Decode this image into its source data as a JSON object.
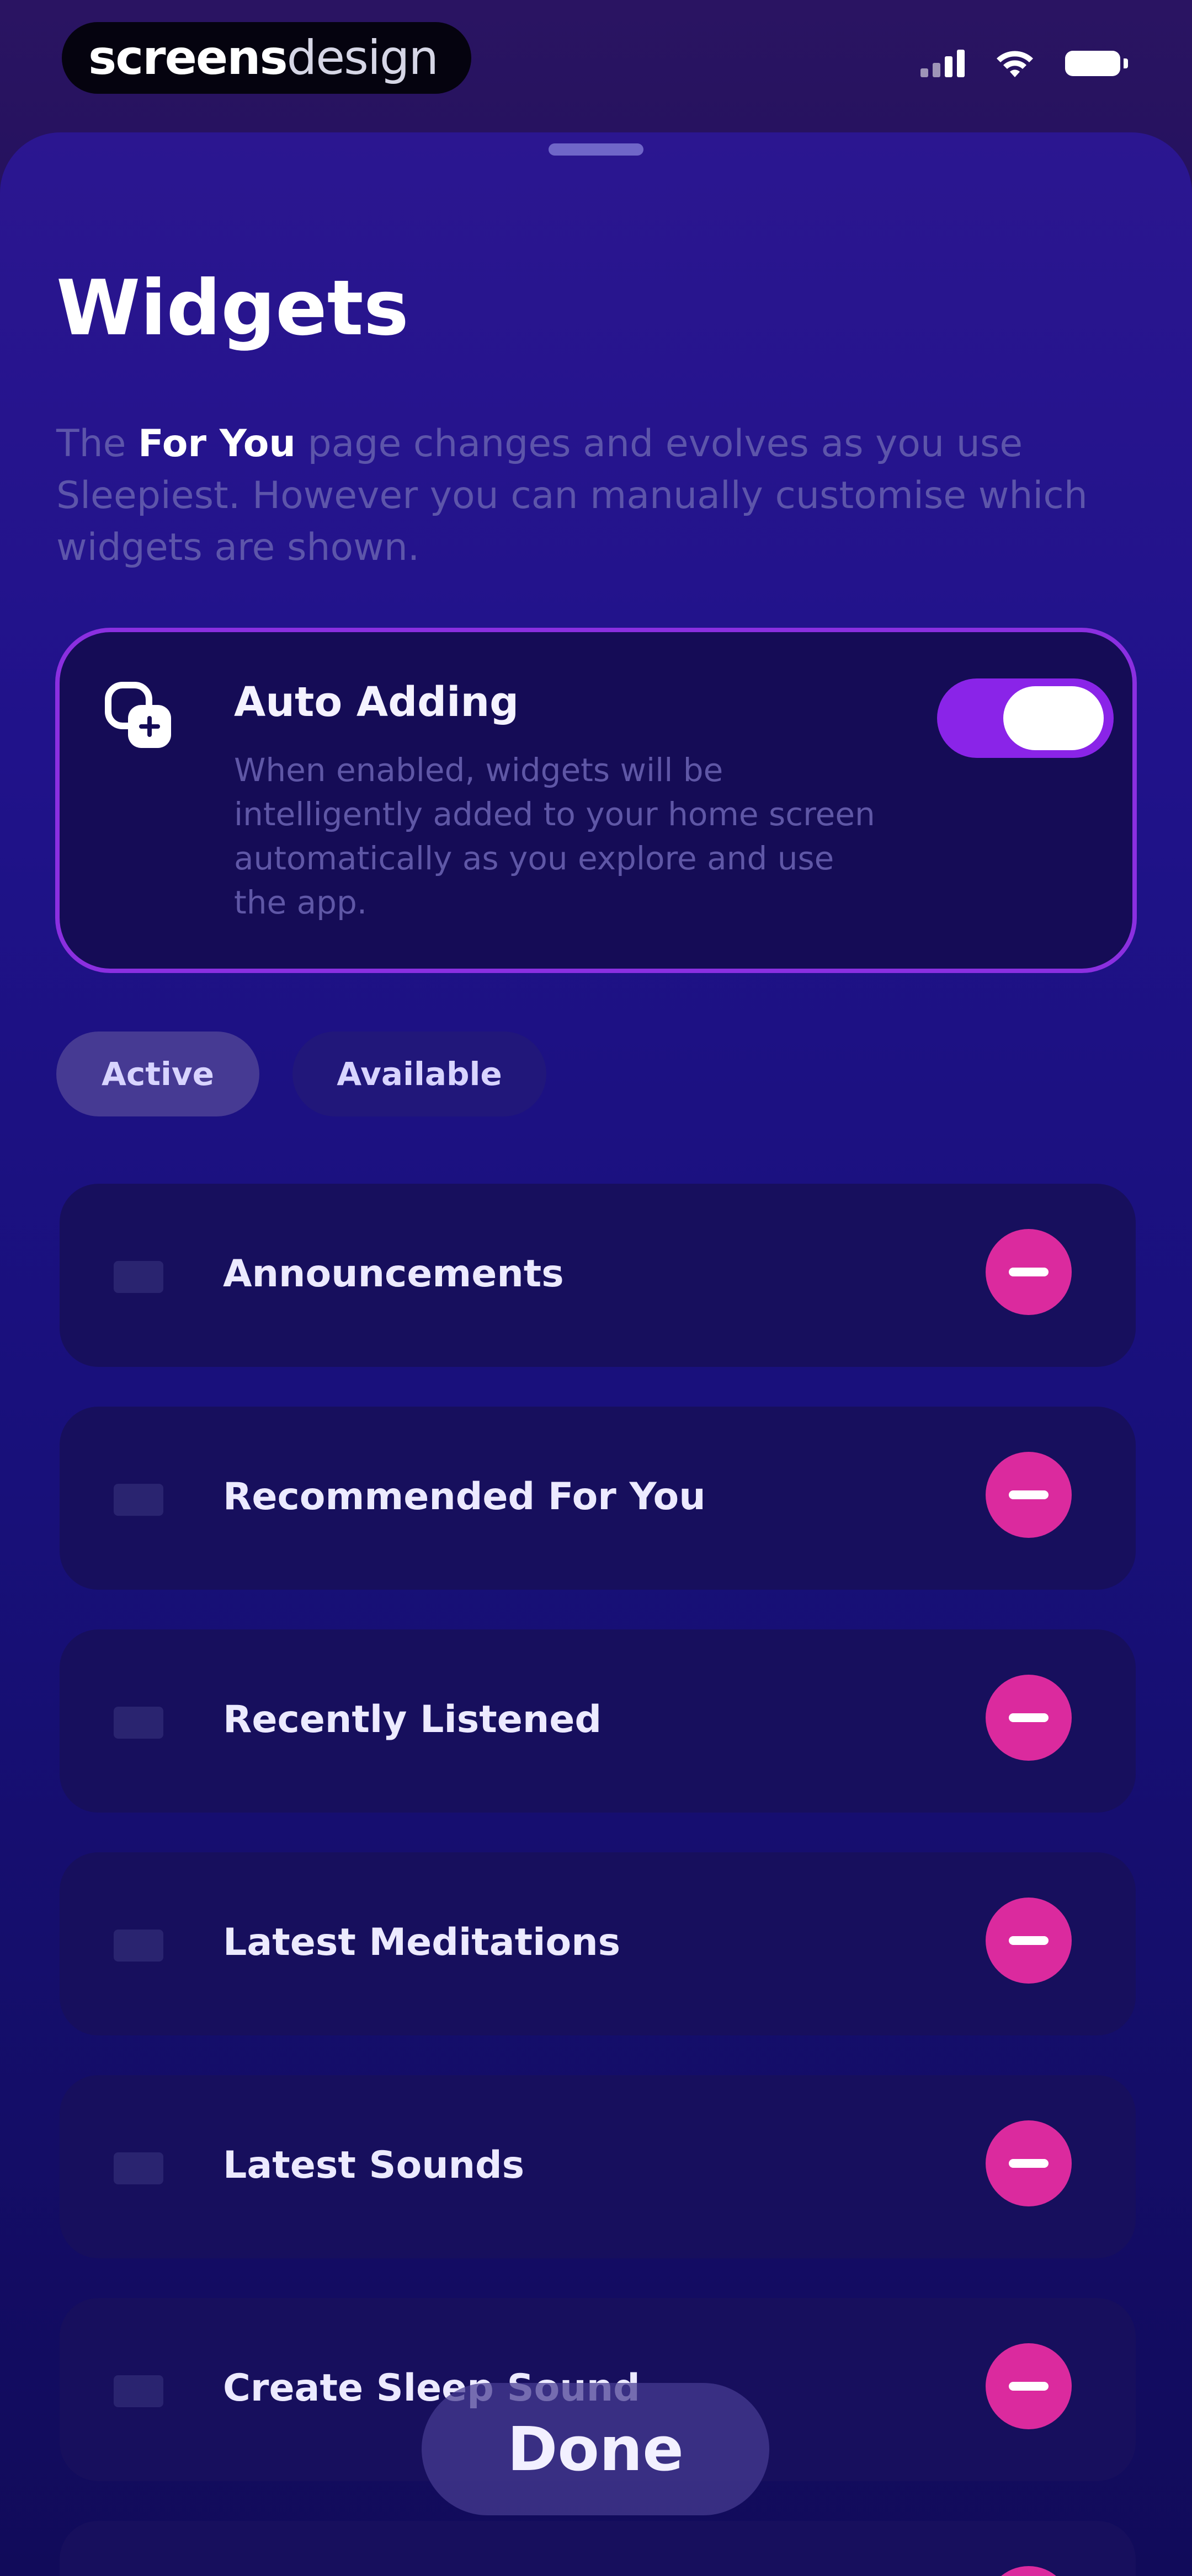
{
  "status_bar": {
    "brand_bold": "screens",
    "brand_light": "design",
    "icons": [
      "signal-icon",
      "wifi-icon",
      "battery-icon"
    ]
  },
  "sheet": {
    "title": "Widgets",
    "intro": {
      "prefix": "The ",
      "highlight": "For You",
      "suffix": " page changes and evolves as you use Sleepiest. However you can manually customise which widgets are shown."
    },
    "auto_adding": {
      "icon": "add-widget-icon",
      "title": "Auto Adding",
      "description": "When enabled, widgets will be intelligently added to your home screen automatically as you explore and use the app.",
      "enabled": true
    },
    "tabs": [
      {
        "label": "Active",
        "selected": true
      },
      {
        "label": "Available",
        "selected": false
      }
    ],
    "widgets": [
      {
        "label": "Announcements"
      },
      {
        "label": "Recommended For You"
      },
      {
        "label": "Recently Listened"
      },
      {
        "label": "Latest Meditations"
      },
      {
        "label": "Latest Sounds"
      },
      {
        "label": "Create Sleep Sound"
      }
    ],
    "done_label": "Done"
  },
  "colors": {
    "accent_purple": "#8a24e8",
    "remove_pink": "#db2a9e",
    "background_navy": "#18107a"
  }
}
